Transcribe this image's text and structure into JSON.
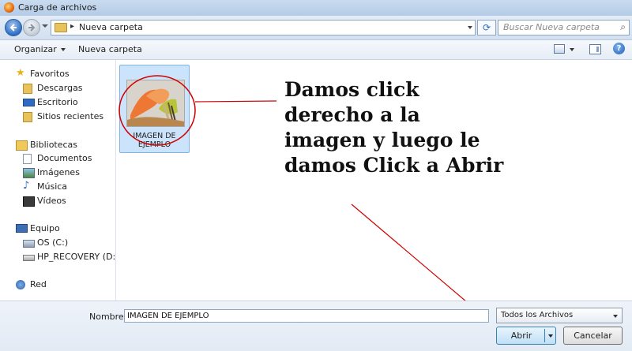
{
  "window": {
    "title": "Carga de archivos"
  },
  "address_bar": {
    "separator": "▸",
    "path": "Nueva carpeta"
  },
  "search": {
    "placeholder": "Buscar Nueva carpeta"
  },
  "toolbar": {
    "organize_label": "Organizar",
    "new_folder_label": "Nueva carpeta"
  },
  "nav_pane": {
    "favorites": {
      "label": "Favoritos",
      "items": [
        "Descargas",
        "Escritorio",
        "Sitios recientes"
      ]
    },
    "libraries": {
      "label": "Bibliotecas",
      "items": [
        "Documentos",
        "Imágenes",
        "Música",
        "Vídeos"
      ]
    },
    "computer": {
      "label": "Equipo",
      "items": [
        "OS (C:)",
        "HP_RECOVERY (D:)"
      ]
    },
    "network": {
      "label": "Red"
    }
  },
  "files": [
    {
      "name": "IMAGEN DE EJEMPLO",
      "selected": true
    }
  ],
  "annotation": {
    "text": "Damos click derecho a la imagen y luego le damos Click a Abrir",
    "color": "#d00000"
  },
  "footer": {
    "name_label": "Nombre:",
    "name_value": "IMAGEN DE EJEMPLO",
    "file_type": "Todos los Archivos",
    "open_label": "Abrir",
    "cancel_label": "Cancelar"
  },
  "colors": {
    "accent": "#2b6fc4",
    "selection": "#cce4fb",
    "annotation": "#d00000"
  }
}
